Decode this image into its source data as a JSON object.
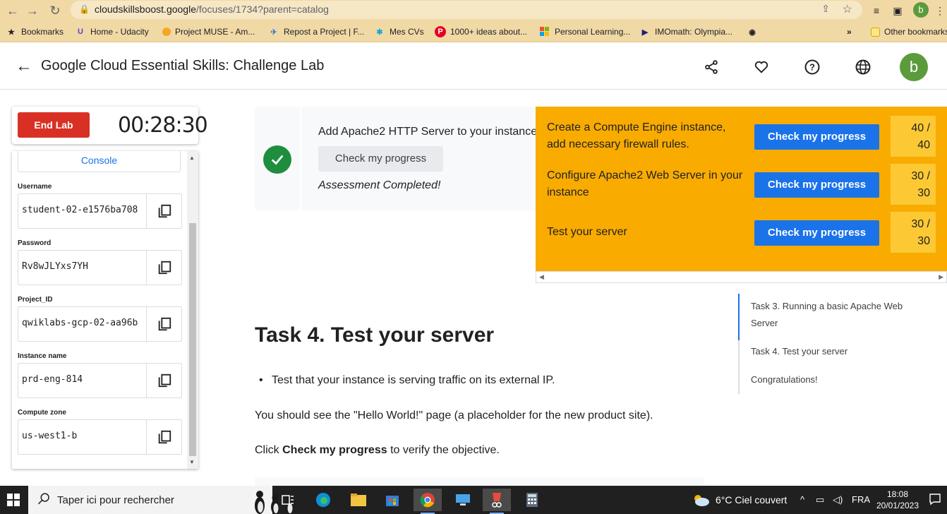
{
  "browser": {
    "url_host": "cloudskillsboost.google",
    "url_path": "/focuses/1734?parent=catalog",
    "profile_initial": "b",
    "bookmarks": [
      {
        "label": "Bookmarks",
        "icon": "star-icon"
      },
      {
        "label": "Home - Udacity",
        "icon": "udacity-icon"
      },
      {
        "label": "Project MUSE - Am...",
        "icon": "muse-icon"
      },
      {
        "label": "Repost a Project | F...",
        "icon": "freelancer-icon"
      },
      {
        "label": "Mes CVs",
        "icon": "cv-icon"
      },
      {
        "label": "1000+ ideas about...",
        "icon": "pinterest-icon"
      },
      {
        "label": "Personal Learning...",
        "icon": "microsoft-icon"
      },
      {
        "label": "IMOmath: Olympia...",
        "icon": "imomath-icon"
      }
    ],
    "overflow": "»",
    "other_bookmarks": "Other bookmarks"
  },
  "header": {
    "title": "Google Cloud Essential Skills: Challenge Lab",
    "avatar_initial": "b"
  },
  "lab": {
    "end_lab_label": "End Lab",
    "timer": "00:28:30",
    "console_label": "Console",
    "fields": [
      {
        "label": "Username",
        "value": "student-02-e1576ba708"
      },
      {
        "label": "Password",
        "value": "Rv8wJLYxs7YH"
      },
      {
        "label": "Project_ID",
        "value": "qwiklabs-gcp-02-aa96b"
      },
      {
        "label": "Instance name",
        "value": "prd-eng-814"
      },
      {
        "label": "Compute zone",
        "value": "us-west1-b"
      }
    ]
  },
  "task_card": {
    "title": "Add Apache2 HTTP Server to your instance",
    "button": "Check my progress",
    "status": "Assessment Completed!"
  },
  "content": {
    "heading": "Task 4. Test your server",
    "bullet": "Test that your instance is serving traffic on its external IP.",
    "para1": "You should see the \"Hello World!\" page (a placeholder for the new product site).",
    "para2_prefix": "Click ",
    "para2_bold": "Check my progress",
    "para2_suffix": " to verify the objective."
  },
  "toc": {
    "items": [
      "Task 3. Running a basic Apache Web Server",
      "Task 4. Test your server",
      "Congratulations!"
    ]
  },
  "progress": {
    "rows": [
      {
        "text": "Create a Compute Engine instance, add necessary firewall rules.",
        "button": "Check my progress",
        "score_top": "40 /",
        "score_bottom": "40"
      },
      {
        "text": "Configure Apache2 Web Server in your instance",
        "button": "Check my progress",
        "score_top": "30 /",
        "score_bottom": "30"
      },
      {
        "text": "Test your server",
        "button": "Check my progress",
        "score_top": "30 /",
        "score_bottom": "30"
      }
    ]
  },
  "taskbar": {
    "search_placeholder": "Taper ici pour rechercher",
    "weather": "6°C  Ciel couvert",
    "language": "FRA",
    "time": "18:08",
    "date": "20/01/2023"
  },
  "colors": {
    "accent_blue": "#1a73e8",
    "end_lab_red": "#d93025",
    "progress_yellow": "#f9ab00",
    "success_green": "#1e8e3e"
  }
}
